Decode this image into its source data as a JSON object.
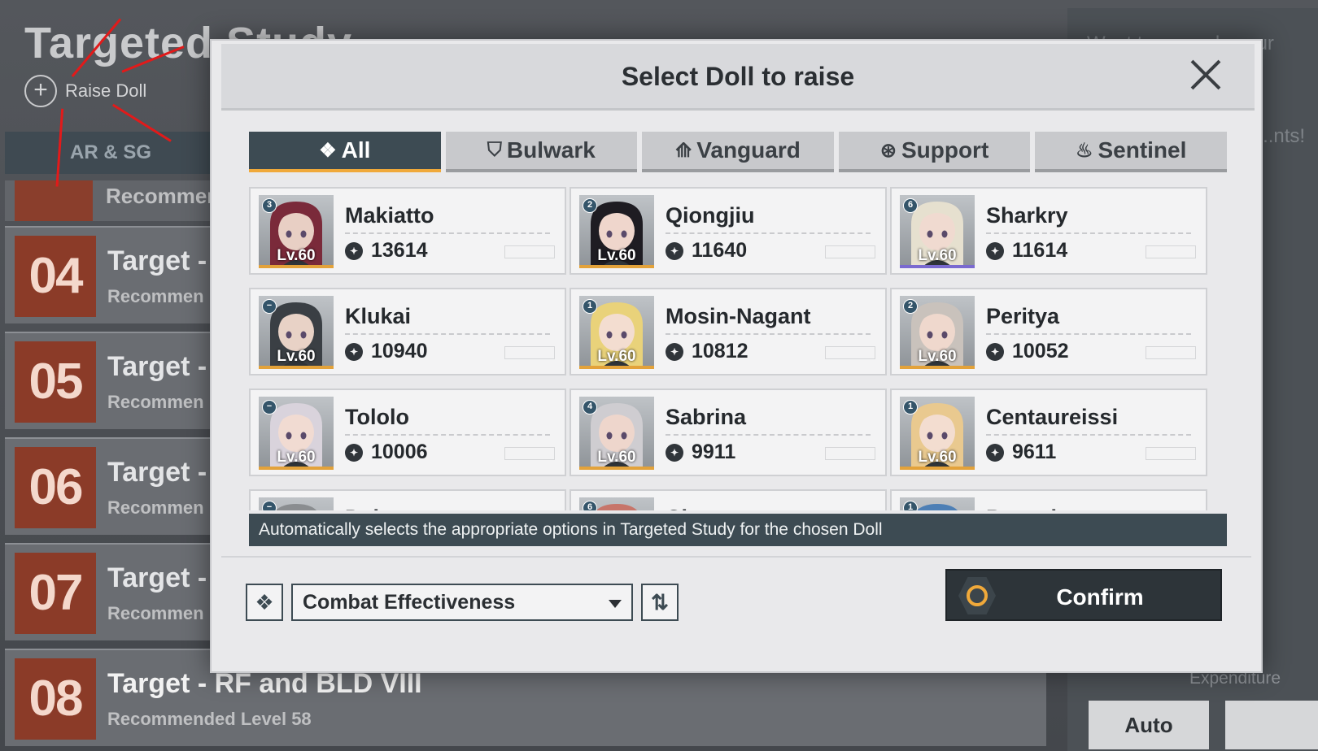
{
  "background": {
    "page_title": "Targeted Study",
    "raise_doll_label": "Raise Doll",
    "tab_label": "AR & SG",
    "partial_card_title": "Recommen",
    "study_cards": [
      {
        "num": "04",
        "title": "Target -",
        "sub": "Recommen"
      },
      {
        "num": "05",
        "title": "Target -",
        "sub": "Recommen"
      },
      {
        "num": "06",
        "title": "Target -",
        "sub": "Recommen"
      },
      {
        "num": "07",
        "title": "Target -",
        "sub": "Recommen"
      },
      {
        "num": "08",
        "title": "Target - RF and BLD VIII",
        "sub": "Recommended Level 58"
      }
    ],
    "right_panel_text": "Want to upgrade your concentr... y elim...",
    "right_panel_text2": "...tely h... ...tiple ... ...nts!",
    "expenditure_label": "Expenditure",
    "auto_label": "Auto"
  },
  "modal": {
    "title": "Select Doll to raise",
    "tabs": [
      {
        "label": "All",
        "icon": "all-class-icon",
        "glyph": "❖",
        "active": true
      },
      {
        "label": "Bulwark",
        "icon": "bulwark-shield-icon",
        "glyph": "⛉",
        "active": false
      },
      {
        "label": "Vanguard",
        "icon": "vanguard-icon",
        "glyph": "⟰",
        "active": false
      },
      {
        "label": "Support",
        "icon": "support-icon",
        "glyph": "⊛",
        "active": false
      },
      {
        "label": "Sentinel",
        "icon": "sentinel-icon",
        "glyph": "♨",
        "active": false
      }
    ],
    "dolls": [
      {
        "name": "Makiatto",
        "power": "13614",
        "level": "Lv.60",
        "badge": "3",
        "hair": "#7a2a3a",
        "skin": "#e8cfc4",
        "bar": "#e3a23a"
      },
      {
        "name": "Qiongjiu",
        "power": "11640",
        "level": "Lv.60",
        "badge": "2",
        "hair": "#1e1c22",
        "skin": "#efd6cc",
        "bar": "#e3a23a"
      },
      {
        "name": "Sharkry",
        "power": "11614",
        "level": "Lv.60",
        "badge": "6",
        "hair": "#e6e0cf",
        "skin": "#f0dad0",
        "bar": "#7a6ad0"
      },
      {
        "name": "Klukai",
        "power": "10940",
        "level": "Lv.60",
        "badge": "−",
        "hair": "#3a3f44",
        "skin": "#e8d2c6",
        "bar": "#e3a23a"
      },
      {
        "name": "Mosin-Nagant",
        "power": "10812",
        "level": "Lv.60",
        "badge": "1",
        "hair": "#e9d27a",
        "skin": "#f3ddd0",
        "bar": "#e3a23a"
      },
      {
        "name": "Perityа",
        "power": "10052",
        "level": "Lv.60",
        "badge": "2",
        "hair": "#c9c2bc",
        "skin": "#efd8cd",
        "bar": "#e3a23a"
      },
      {
        "name": "Tololo",
        "power": "10006",
        "level": "Lv.60",
        "badge": "−",
        "hair": "#d9d3dc",
        "skin": "#f1dbd2",
        "bar": "#e3a23a"
      },
      {
        "name": "Sabrina",
        "power": "9911",
        "level": "Lv.60",
        "badge": "4",
        "hair": "#cfcdd1",
        "skin": "#eed6cc",
        "bar": "#e3a23a"
      },
      {
        "name": "Centaureissi",
        "power": "9611",
        "level": "Lv.60",
        "badge": "1",
        "hair": "#e9c98f",
        "skin": "#f3ddd0",
        "bar": "#e3a23a"
      },
      {
        "name": "Dai…",
        "power": "",
        "level": "",
        "badge": "−",
        "hair": "#8a8d90",
        "skin": "#e8d2c6",
        "bar": "#e3a23a"
      },
      {
        "name": "Cheet…",
        "power": "",
        "level": "",
        "badge": "6",
        "hair": "#c7756a",
        "skin": "#efd6cc",
        "bar": "#e3a23a"
      },
      {
        "name": "Papash…",
        "power": "",
        "level": "",
        "badge": "1",
        "hair": "#4d7fb5",
        "skin": "#f1dbd2",
        "bar": "#e3a23a"
      }
    ],
    "info_text": "Automatically selects the appropriate options in Targeted Study for the chosen Doll",
    "sort_by": "Combat Effectiveness",
    "confirm_label": "Confirm"
  },
  "colors": {
    "accent": "#f0a93a",
    "dark": "#3d4b53",
    "level_orange": "#8b3b28"
  }
}
